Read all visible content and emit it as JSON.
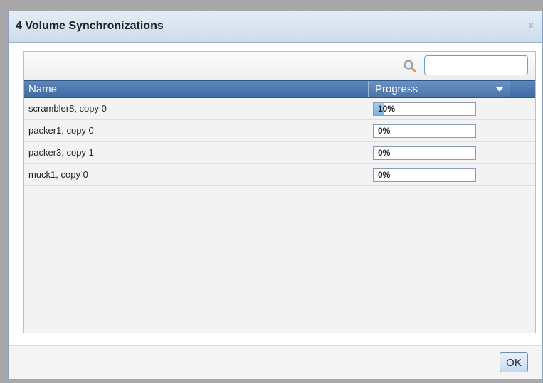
{
  "dialog": {
    "title": "4 Volume Synchronizations",
    "close_label": "x",
    "ok_label": "OK"
  },
  "search": {
    "value": "",
    "icon": "search-icon"
  },
  "grid": {
    "columns": {
      "name": "Name",
      "progress": "Progress"
    },
    "rows": [
      {
        "name": "scrambler8, copy 0",
        "progress_label": "10%",
        "progress": 0.1
      },
      {
        "name": "packer1, copy 0",
        "progress_label": "0%",
        "progress": 0
      },
      {
        "name": "packer3, copy 1",
        "progress_label": "0%",
        "progress": 0
      },
      {
        "name": "muck1, copy 0",
        "progress_label": "0%",
        "progress": 0
      }
    ]
  },
  "colors": {
    "header_blue": "#3e6aa2",
    "progress_fill": "#7fb1e4"
  }
}
